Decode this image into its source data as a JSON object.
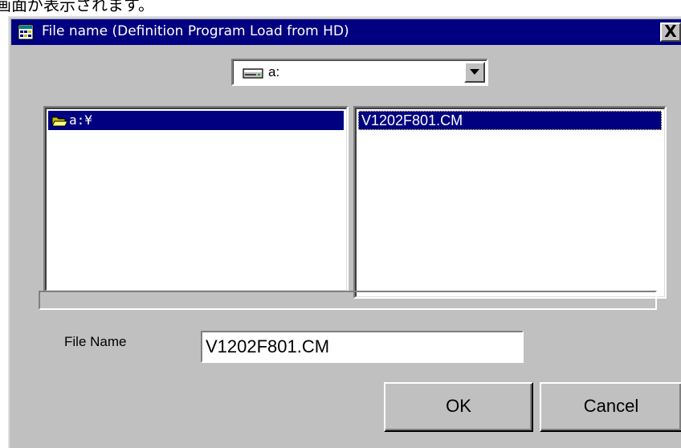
{
  "caption": "画面が表示されます。",
  "window": {
    "title": "File name (Definition Program Load from HD)",
    "close_label": "X",
    "icon": "app-icon"
  },
  "drive": {
    "selected": "a:",
    "icon": "drive-icon"
  },
  "directories": [
    {
      "label": "a:¥",
      "icon": "folder-open-icon",
      "selected": true
    }
  ],
  "files": [
    {
      "label": "V1202F801.CM",
      "selected": true
    }
  ],
  "filename": {
    "label": "File Name",
    "value": "V1202F801.CM"
  },
  "buttons": {
    "ok": "OK",
    "cancel": "Cancel"
  },
  "colors": {
    "titlebar": "#000080",
    "face": "#c0c0c0",
    "selection": "#000080"
  }
}
